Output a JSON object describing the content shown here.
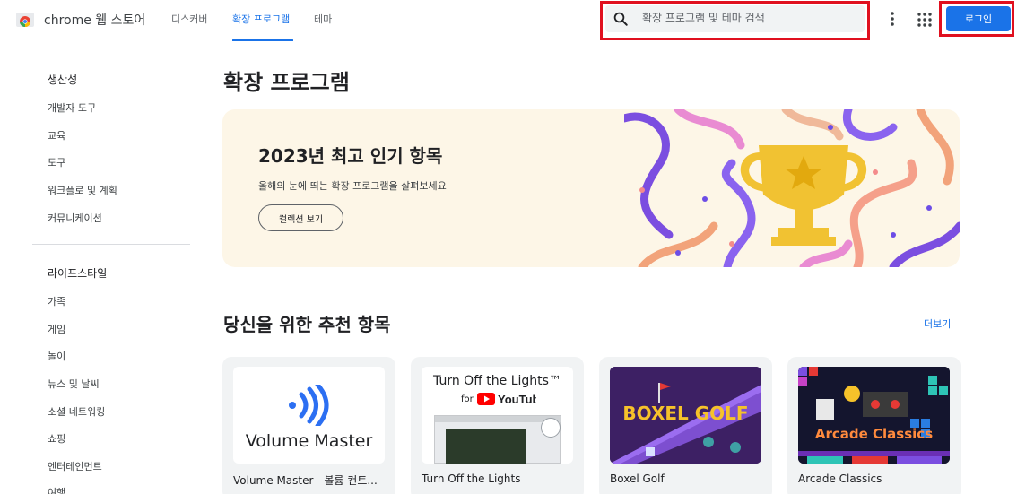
{
  "header": {
    "brand": "chrome 웹 스토어",
    "tabs": [
      {
        "label": "디스커버",
        "active": false
      },
      {
        "label": "확장 프로그램",
        "active": true
      },
      {
        "label": "테마",
        "active": false
      }
    ],
    "search_placeholder": "확장 프로그램 및 테마 검색",
    "login_label": "로그인",
    "icons": [
      "chrome-logo",
      "search-icon",
      "more-vert-icon",
      "apps-grid-icon"
    ],
    "accent_color": "#1a73e8",
    "highlight_color": "#e0101f"
  },
  "sidebar": {
    "groups": [
      {
        "heading": "생산성",
        "items": [
          "개발자 도구",
          "교육",
          "도구",
          "워크플로 및 계획",
          "커뮤니케이션"
        ]
      },
      {
        "heading": "라이프스타일",
        "items": [
          "가족",
          "게임",
          "놀이",
          "뉴스 및 날씨",
          "소셜 네트워킹",
          "쇼핑",
          "엔터테인먼트",
          "여행"
        ]
      }
    ]
  },
  "main": {
    "title": "확장 프로그램",
    "banner": {
      "title": "2023년 최고 인기 항목",
      "subtitle": "올해의 눈에 띄는 확장 프로그램을 살펴보세요",
      "button_label": "컬렉션 보기",
      "background_color": "#fdf6e7",
      "art_icon": "trophy-icon"
    },
    "recommended": {
      "title": "당신을 위한 추천 항목",
      "more_label": "더보기",
      "cards": [
        {
          "name": "Volume Master - 볼륨 컨트...",
          "thumb_text": "Volume Master"
        },
        {
          "name": "Turn Off the Lights",
          "thumb_title": "Turn Off the Lights™",
          "thumb_for": "for",
          "thumb_brand": "YouTube"
        },
        {
          "name": "Boxel Golf",
          "thumb_text": "BOXEL GOLF"
        },
        {
          "name": "Arcade Classics",
          "thumb_text": "Arcade Classics"
        }
      ]
    }
  }
}
